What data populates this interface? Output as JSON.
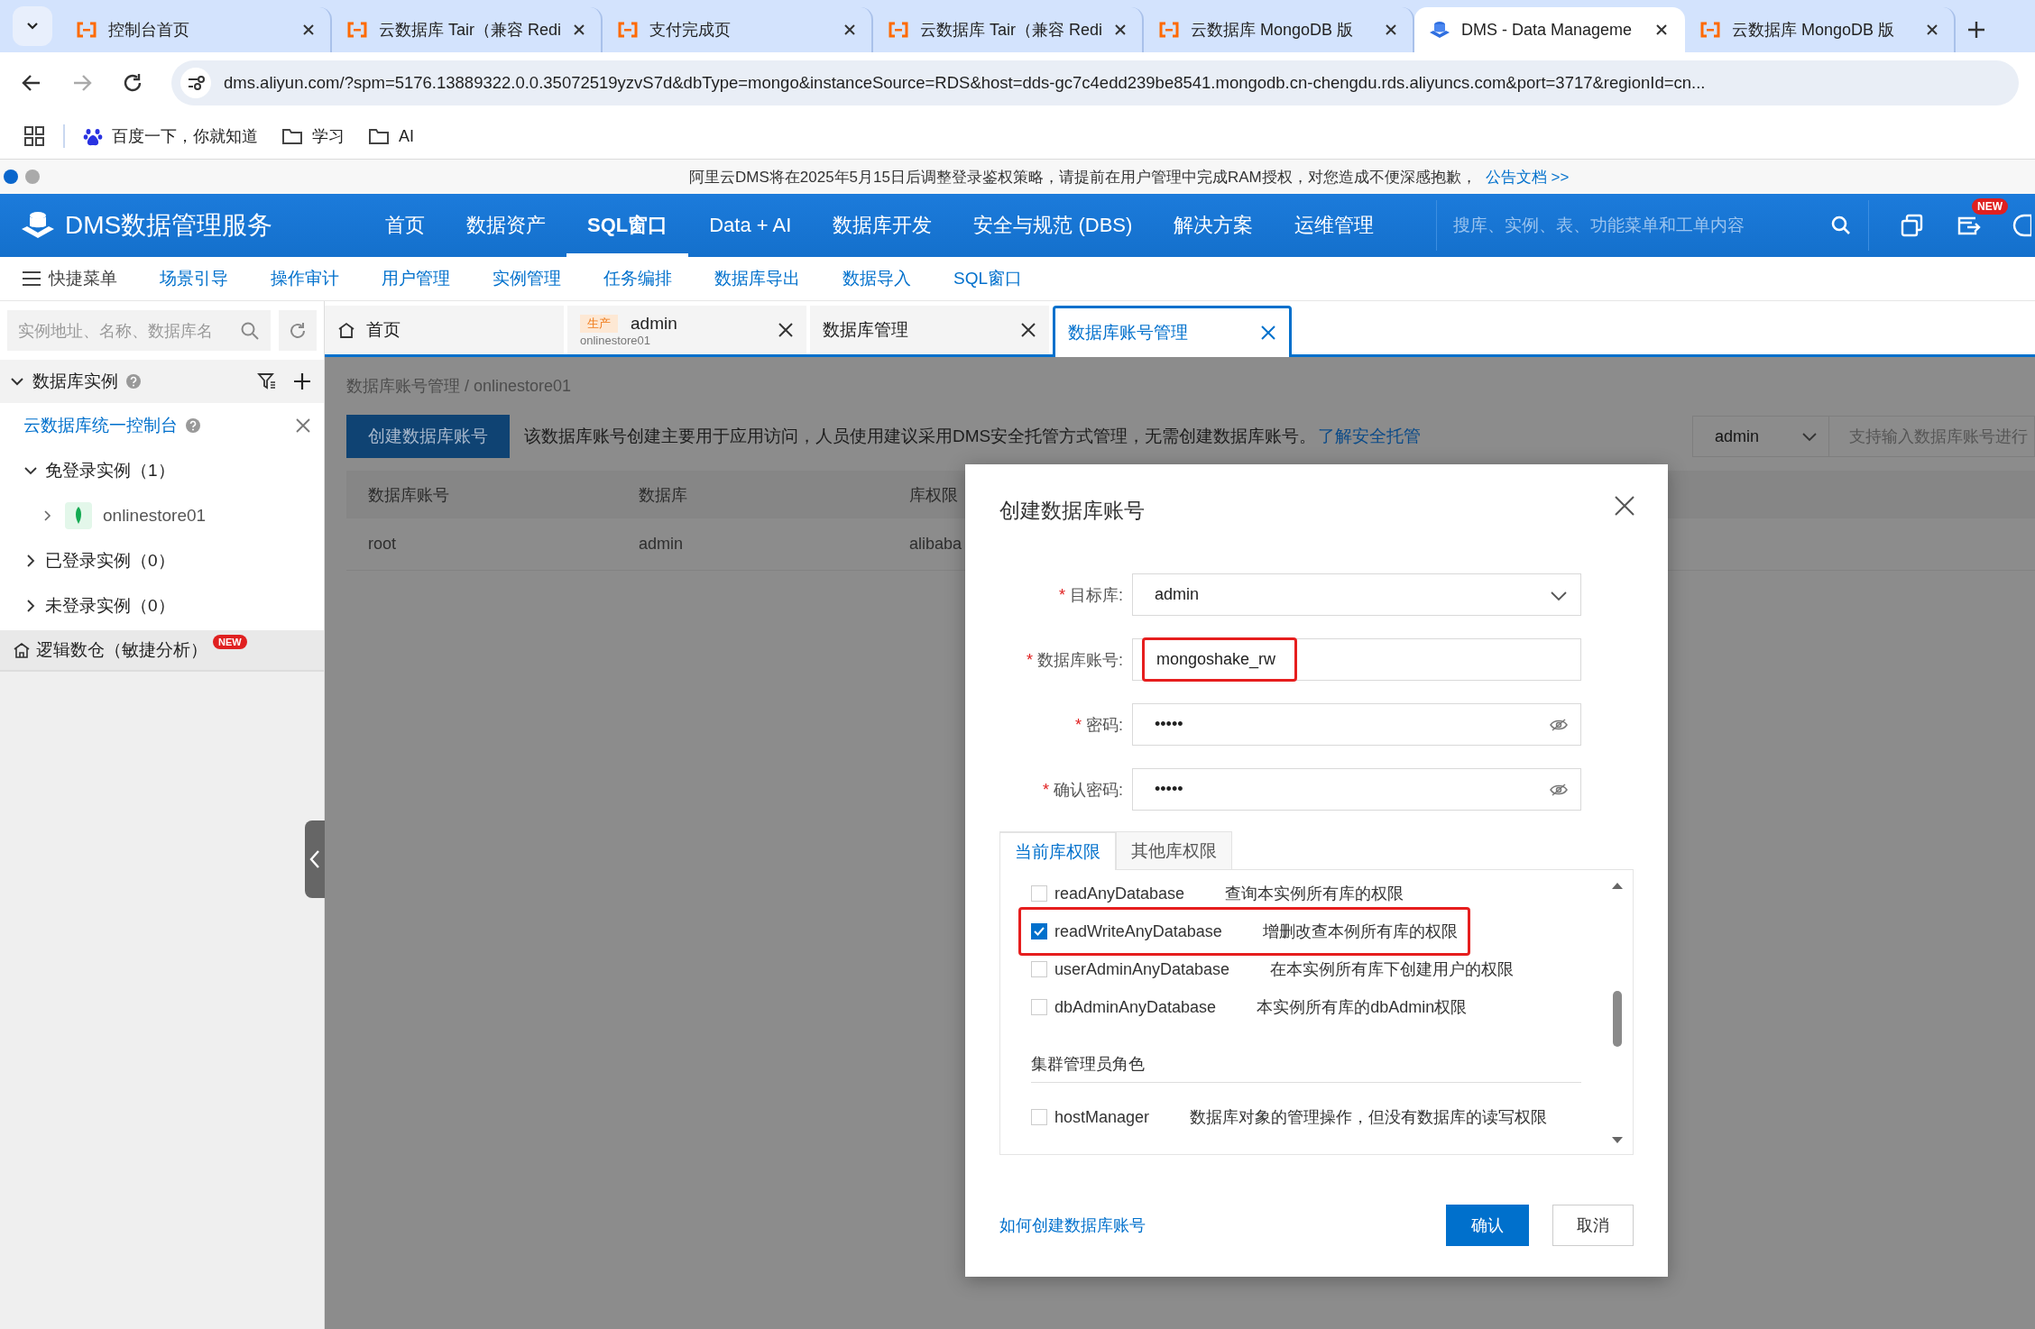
{
  "browser": {
    "tabs": [
      {
        "title": "控制台首页",
        "selected": false,
        "kind": "console"
      },
      {
        "title": "云数据库 Tair（兼容 Redi",
        "selected": false,
        "kind": "console"
      },
      {
        "title": "支付完成页",
        "selected": false,
        "kind": "console"
      },
      {
        "title": "云数据库 Tair（兼容 Redi",
        "selected": false,
        "kind": "console"
      },
      {
        "title": "云数据库 MongoDB 版",
        "selected": false,
        "kind": "console"
      },
      {
        "title": "DMS - Data Manageme",
        "selected": true,
        "kind": "dms"
      },
      {
        "title": "云数据库 MongoDB 版",
        "selected": false,
        "kind": "console"
      }
    ],
    "url": "dms.aliyun.com/?spm=5176.13889322.0.0.35072519yzvS7d&dbType=mongo&instanceSource=RDS&host=dds-gc7c4edd239be8541.mongodb.cn-chengdu.rds.aliyuncs.com&port=3717&regionId=cn...",
    "bookmarks": [
      {
        "label": "百度一下，你就知道",
        "kind": "baidu"
      },
      {
        "label": "学习",
        "kind": "folder"
      },
      {
        "label": "AI",
        "kind": "folder"
      }
    ]
  },
  "notice": {
    "text": "阿里云DMS将在2025年5月15日后调整登录鉴权策略，请提前在用户管理中完成RAM授权，对您造成不便深感抱歉，",
    "link": "公告文档 >>"
  },
  "header": {
    "product": "DMS数据管理服务",
    "nav": [
      {
        "label": "首页",
        "selected": false
      },
      {
        "label": "数据资产",
        "selected": false
      },
      {
        "label": "SQL窗口",
        "selected": true
      },
      {
        "label": "Data + AI",
        "selected": false
      },
      {
        "label": "数据库开发",
        "selected": false
      },
      {
        "label": "安全与规范 (DBS)",
        "selected": false
      },
      {
        "label": "解决方案",
        "selected": false
      },
      {
        "label": "运维管理",
        "selected": false
      }
    ],
    "search": {
      "placeholder": "搜库、实例、表、功能菜单和工单内容"
    },
    "badge": "NEW"
  },
  "quick_menu": {
    "title": "快捷菜单",
    "links": [
      "场景引导",
      "操作审计",
      "用户管理",
      "实例管理",
      "任务编排",
      "数据库导出",
      "数据导入",
      "SQL窗口"
    ]
  },
  "sidebar": {
    "search": {
      "placeholder": "实例地址、名称、数据库名"
    },
    "section": "数据库实例",
    "console_link": "云数据库统一控制台",
    "tree": [
      {
        "label": "免登录实例（1）",
        "expanded": true,
        "children": [
          {
            "label": "onlinestore01",
            "expanded": false
          }
        ]
      },
      {
        "label": "已登录实例（0）",
        "expanded": false
      },
      {
        "label": "未登录实例（0）",
        "expanded": false
      }
    ],
    "footer": {
      "label": "逻辑数仓（敏捷分析）",
      "badge": "NEW"
    }
  },
  "work_tabs": [
    {
      "kind": "home",
      "label": "首页",
      "selected": false
    },
    {
      "kind": "instance",
      "tag": "生产",
      "label": "admin",
      "sublabel": "onlinestore01",
      "selected": false
    },
    {
      "kind": "page",
      "label": "数据库管理",
      "selected": false
    },
    {
      "kind": "page",
      "label": "数据库账号管理",
      "selected": true
    }
  ],
  "page": {
    "breadcrumb": "数据库账号管理 / onlinestore01",
    "create_button": "创建数据库账号",
    "description": "该数据库账号创建主要用于应用访问，人员使用建议采用DMS安全托管方式管理，无需创建数据库账号。",
    "description_link": "了解安全托管",
    "filter": {
      "value": "admin"
    },
    "search": {
      "placeholder": "支持输入数据库账号进行"
    },
    "table": {
      "columns": [
        "数据库账号",
        "数据库",
        "库权限"
      ],
      "rows": [
        [
          "root",
          "admin",
          "alibaba"
        ]
      ]
    }
  },
  "dialog": {
    "title": "创建数据库账号",
    "fields": [
      {
        "label": "目标库:",
        "mark": "*",
        "kind": "select",
        "value": "admin",
        "highlighted": false
      },
      {
        "label": "数据库账号:",
        "mark": "*",
        "kind": "text",
        "value": "mongoshake_rw",
        "highlighted": true
      },
      {
        "label": "密码:",
        "mark": "*",
        "kind": "password",
        "value": "•••••",
        "highlighted": false
      },
      {
        "label": "确认密码:",
        "mark": "*",
        "kind": "password",
        "value": "•••••",
        "highlighted": false
      }
    ],
    "tabs": [
      {
        "label": "当前库权限",
        "selected": true
      },
      {
        "label": "其他库权限",
        "selected": false
      }
    ],
    "permissions": [
      {
        "kind": "item",
        "name": "readAnyDatabase",
        "description": "查询本实例所有库的权限",
        "checked": false,
        "highlighted": false
      },
      {
        "kind": "item",
        "name": "readWriteAnyDatabase",
        "description": "增删改查本例所有库的权限",
        "checked": true,
        "highlighted": true
      },
      {
        "kind": "item",
        "name": "userAdminAnyDatabase",
        "description": "在本实例所有库下创建用户的权限",
        "checked": false,
        "highlighted": false
      },
      {
        "kind": "item",
        "name": "dbAdminAnyDatabase",
        "description": "本实例所有库的dbAdmin权限",
        "checked": false,
        "highlighted": false
      },
      {
        "kind": "heading",
        "label": "集群管理员角色"
      },
      {
        "kind": "item",
        "name": "hostManager",
        "description": "数据库对象的管理操作，但没有数据库的读写权限",
        "checked": false,
        "highlighted": false
      }
    ],
    "help_link": "如何创建数据库账号",
    "buttons": [
      {
        "label": "确认",
        "kind": "primary"
      },
      {
        "label": "取消",
        "kind": "default"
      }
    ]
  }
}
